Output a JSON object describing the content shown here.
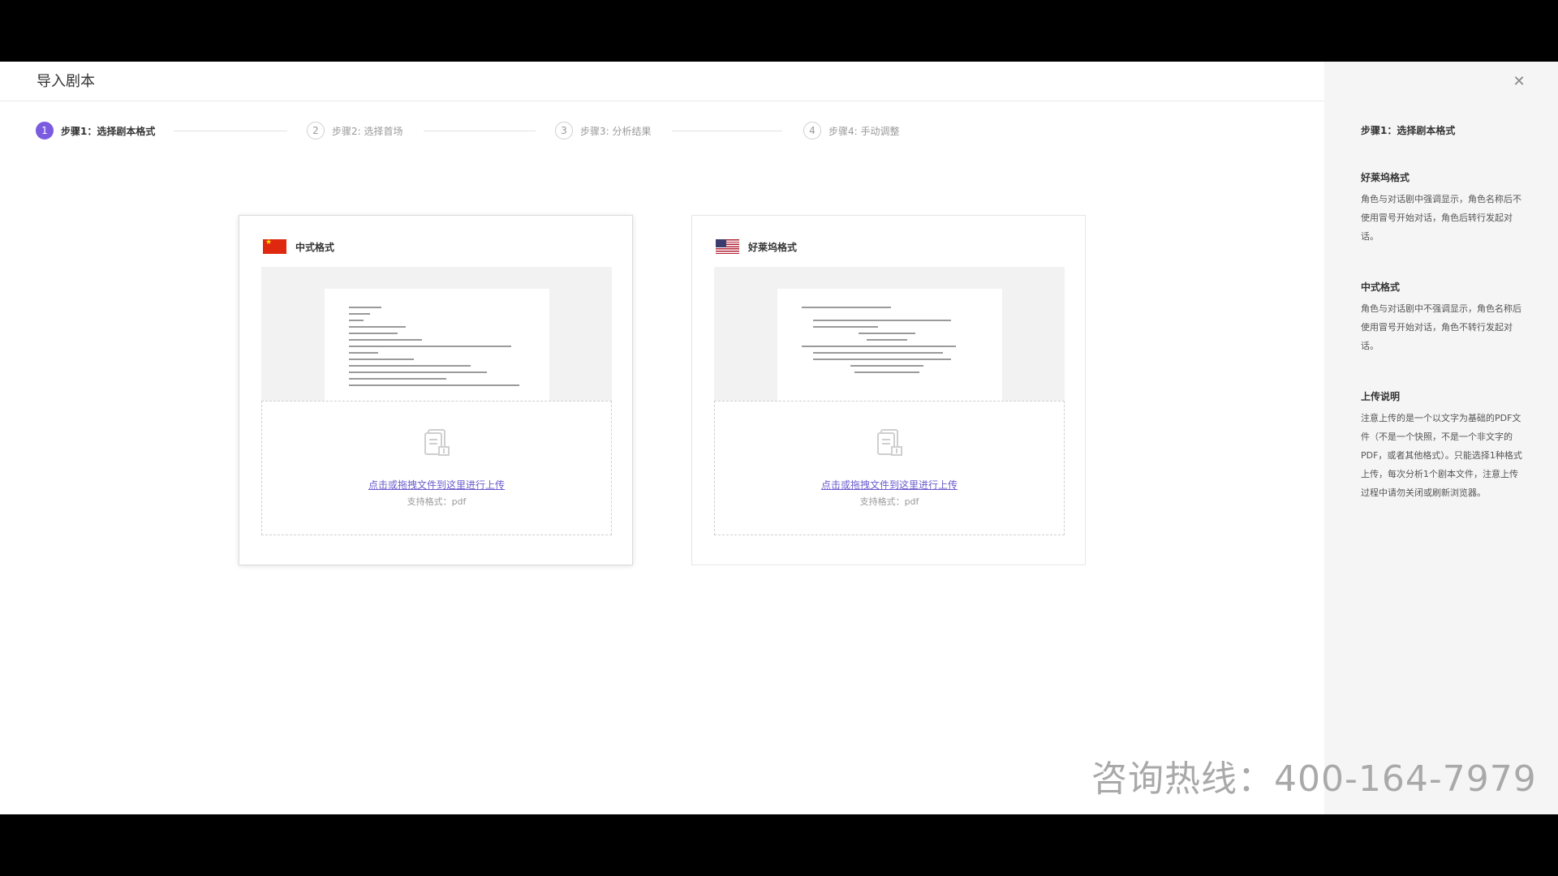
{
  "dialog": {
    "title": "导入剧本"
  },
  "steps": [
    {
      "num": "1",
      "label": "步骤1：选择剧本格式",
      "active": true
    },
    {
      "num": "2",
      "label": "步骤2: 选择首场",
      "active": false
    },
    {
      "num": "3",
      "label": "步骤3: 分析结果",
      "active": false
    },
    {
      "num": "4",
      "label": "步骤4: 手动调整",
      "active": false
    }
  ],
  "cards": [
    {
      "title": "中式格式",
      "flag_icon": "china-flag-icon",
      "upload_link": "点击或拖拽文件到这里进行上传",
      "upload_hint": "支持格式：pdf"
    },
    {
      "title": "好莱坞格式",
      "flag_icon": "usa-flag-icon",
      "upload_link": "点击或拖拽文件到这里进行上传",
      "upload_hint": "支持格式：pdf"
    }
  ],
  "watermark": "咨询热线：400-164-7979",
  "sidebar": {
    "close_icon": "close-icon",
    "step_title": "步骤1：选择剧本格式",
    "sections": [
      {
        "heading": "好莱坞格式",
        "text": "角色与对话剧中强调显示，角色名称后不使用冒号开始对话，角色后转行发起对话。"
      },
      {
        "heading": "中式格式",
        "text": "角色与对话剧中不强调显示，角色名称后使用冒号开始对话，角色不转行发起对话。"
      },
      {
        "heading": "上传说明",
        "text": "注意上传的是一个以文字为基础的PDF文件（不是一个快照，不是一个非文字的PDF，或者其他格式）。只能选择1种格式上传，每次分析1个剧本文件，注意上传过程中请勿关闭或刷新浏览器。"
      }
    ]
  },
  "colors": {
    "accent": "#7b5ce0",
    "link": "#6a5acd"
  }
}
